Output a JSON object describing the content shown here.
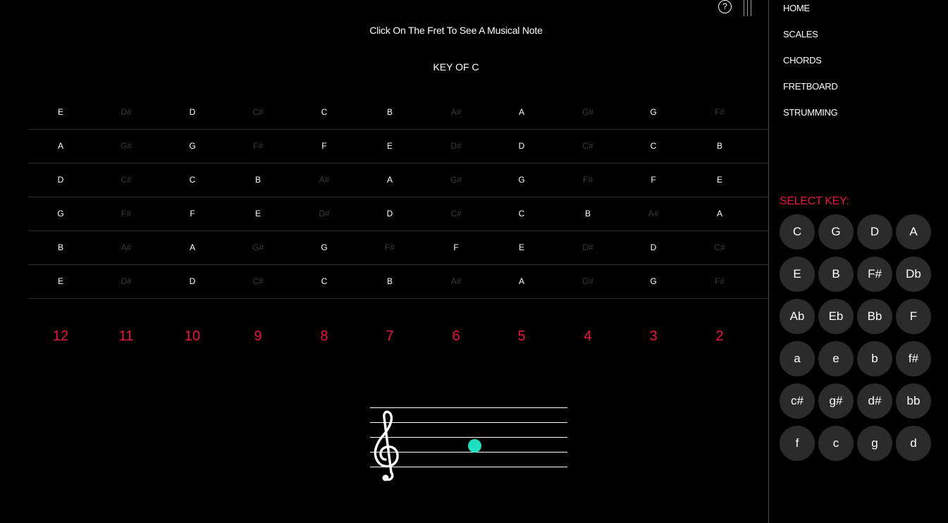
{
  "header": {
    "instruction": "Click On The Fret To See A Musical Note",
    "key_title": "KEY OF C",
    "help_symbol": "?",
    "help_icon": "question-circle-icon",
    "menu_icon": "hamburger-vertical-icon"
  },
  "fretboard": {
    "strings": [
      {
        "notes": [
          "E",
          "D#",
          "D",
          "C#",
          "C",
          "B",
          "A#",
          "A",
          "G#",
          "G",
          "F#"
        ],
        "in_key": [
          true,
          false,
          true,
          false,
          true,
          true,
          false,
          true,
          false,
          true,
          false
        ]
      },
      {
        "notes": [
          "A",
          "G#",
          "G",
          "F#",
          "F",
          "E",
          "D#",
          "D",
          "C#",
          "C",
          "B"
        ],
        "in_key": [
          true,
          false,
          true,
          false,
          true,
          true,
          false,
          true,
          false,
          true,
          true
        ]
      },
      {
        "notes": [
          "D",
          "C#",
          "C",
          "B",
          "A#",
          "A",
          "G#",
          "G",
          "F#",
          "F",
          "E"
        ],
        "in_key": [
          true,
          false,
          true,
          true,
          false,
          true,
          false,
          true,
          false,
          true,
          true
        ]
      },
      {
        "notes": [
          "G",
          "F#",
          "F",
          "E",
          "D#",
          "D",
          "C#",
          "C",
          "B",
          "A#",
          "A"
        ],
        "in_key": [
          true,
          false,
          true,
          true,
          false,
          true,
          false,
          true,
          true,
          false,
          true
        ]
      },
      {
        "notes": [
          "B",
          "A#",
          "A",
          "G#",
          "G",
          "F#",
          "F",
          "E",
          "D#",
          "D",
          "C#"
        ],
        "in_key": [
          true,
          false,
          true,
          false,
          true,
          false,
          true,
          true,
          false,
          true,
          false
        ]
      },
      {
        "notes": [
          "E",
          "D#",
          "D",
          "C#",
          "C",
          "B",
          "A#",
          "A",
          "G#",
          "G",
          "F#"
        ],
        "in_key": [
          true,
          false,
          true,
          false,
          true,
          true,
          false,
          true,
          false,
          true,
          false
        ]
      }
    ],
    "fret_numbers": [
      "12",
      "11",
      "10",
      "9",
      "8",
      "7",
      "6",
      "5",
      "4",
      "3",
      "2"
    ],
    "dim_color": "#3a3a3a",
    "active_color": "#ffffff"
  },
  "staff": {
    "clef_icon": "treble-clef-icon",
    "note_color": "#1ee0c0"
  },
  "sidebar": {
    "nav": [
      "HOME",
      "SCALES",
      "CHORDS",
      "FRETBOARD",
      "STRUMMING"
    ],
    "select_key_label": "SELECT KEY:",
    "keys": [
      "C",
      "G",
      "D",
      "A",
      "E",
      "B",
      "F#",
      "Db",
      "Ab",
      "Eb",
      "Bb",
      "F",
      "a",
      "e",
      "b",
      "f#",
      "c#",
      "g#",
      "d#",
      "bb",
      "f",
      "c",
      "g",
      "d"
    ]
  },
  "colors": {
    "accent": "#e8163c",
    "background": "#000000",
    "key_button_bg": "#2b2b2b"
  }
}
